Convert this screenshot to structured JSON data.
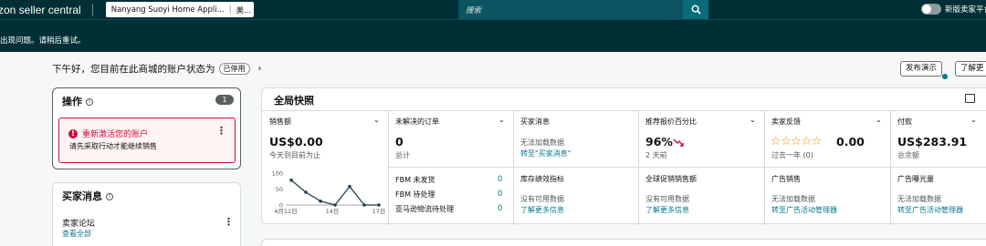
{
  "topbar": {
    "logo_text": "zon seller central",
    "store_name": "Nanyang Suoyi Home Appli...",
    "marketplace": "美...",
    "search_placeholder": "搜索",
    "toggle_label": "新版卖家平台"
  },
  "banner": {
    "text": "出现问题。请稍后重试。"
  },
  "greeting": {
    "text": "下午好，您目前在此商城的账户状态为",
    "status": "已停用",
    "publish_button": "发布演示",
    "learn_button": "了解更"
  },
  "actions": {
    "title": "操作",
    "count": "1",
    "alert_title": "重新激活您的账户",
    "alert_sub": "请先采取行动才能继续销售"
  },
  "buyer_messages": {
    "title": "买家消息",
    "forum_label": "卖家论坛",
    "forum_link": "查看全部"
  },
  "snapshot": {
    "title": "全局快照",
    "sales": {
      "title": "销售额",
      "value": "US$0.00",
      "sub": "今天到目前为止",
      "chart": {
        "type": "line",
        "y_ticks": [
          "100",
          "50",
          "0"
        ],
        "x_ticks": [
          "4月11日",
          "14日",
          "17日"
        ],
        "values": [
          78,
          40,
          12,
          0,
          58,
          0,
          0
        ]
      }
    },
    "orders": {
      "title": "未解决的订单",
      "value": "0",
      "sub": "总计",
      "rows": [
        {
          "label": "FBM 未发货",
          "value": "0"
        },
        {
          "label": "FBM 待处理",
          "value": "0"
        },
        {
          "label": "亚马逊物流待处理",
          "value": "0"
        }
      ]
    },
    "buyer_msgs": {
      "title": "买家消息",
      "sub": "无法加载数据",
      "link": "转至\"买家消息\""
    },
    "inventory": {
      "title": "库存绩效指标",
      "sub": "没有可用数据",
      "link": "了解更多信息"
    },
    "featured_offer": {
      "title": "推荐报价百分比",
      "value": "96%",
      "sub": "2 天前"
    },
    "global_promo": {
      "title": "全球促销销售额",
      "sub": "没有可用数据",
      "link": "了解更多信息"
    },
    "feedback": {
      "title": "卖家反馈",
      "rating": "0.00",
      "stars": "☆☆☆☆☆",
      "sub": "过去一年 (0)"
    },
    "ad_sales": {
      "title": "广告销售",
      "sub": "无法加载数据",
      "link": "转至广告活动管理器"
    },
    "payments": {
      "title": "付款",
      "value": "US$283.91",
      "sub": "总余额"
    },
    "ad_impressions": {
      "title": "广告曝光量",
      "sub": "无法加载数据",
      "link": "转至广告活动管理器"
    }
  },
  "colors": {
    "topbar_bg": "#002f36",
    "accent_link": "#047a8e",
    "error": "#cc0c39",
    "star": "#e38e0d",
    "trend_down": "#cc0c39"
  }
}
